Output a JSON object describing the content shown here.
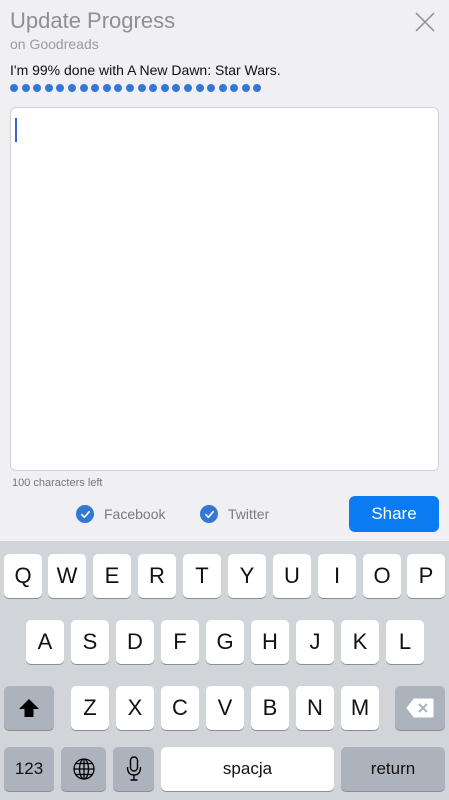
{
  "header": {
    "title": "Update Progress",
    "subtitle": "on Goodreads",
    "close_icon": "close-icon"
  },
  "status": {
    "text": "I'm 99% done with A New Dawn: Star Wars.",
    "progress_percent": 99,
    "dot_count": 22
  },
  "composer": {
    "value": "",
    "chars_left": "100 characters left"
  },
  "share_options": {
    "facebook_label": "Facebook",
    "facebook_checked": true,
    "twitter_label": "Twitter",
    "twitter_checked": true,
    "share_label": "Share"
  },
  "colors": {
    "accent": "#0a7bf0",
    "dot": "#3478d6",
    "background": "#efeff4",
    "keyboard": "#d1d4d9"
  },
  "keyboard": {
    "row1": [
      "Q",
      "W",
      "E",
      "R",
      "T",
      "Y",
      "U",
      "I",
      "O",
      "P"
    ],
    "row2": [
      "A",
      "S",
      "D",
      "F",
      "G",
      "H",
      "J",
      "K",
      "L"
    ],
    "row3": [
      "Z",
      "X",
      "C",
      "V",
      "B",
      "N",
      "M"
    ],
    "shift_icon": "shift-icon",
    "delete_icon": "backspace-icon",
    "numbers_label": "123",
    "globe_icon": "globe-icon",
    "mic_icon": "microphone-icon",
    "space_label": "spacja",
    "return_label": "return"
  }
}
